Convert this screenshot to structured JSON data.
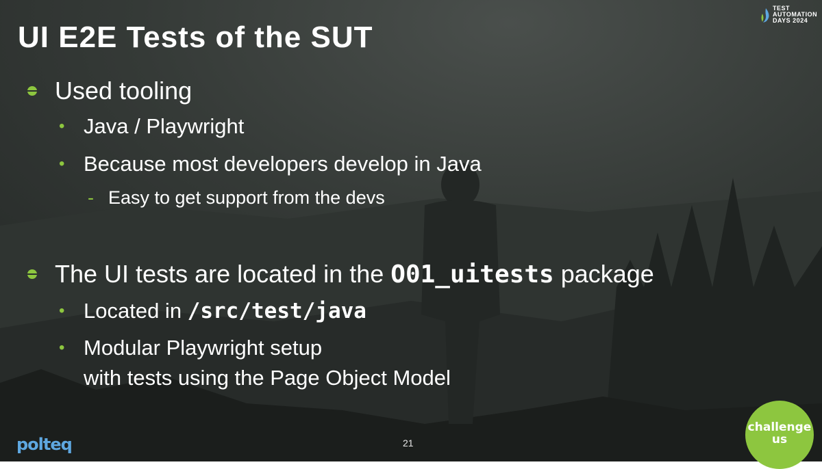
{
  "slide": {
    "title": "UI E2E Tests of the SUT",
    "page_number": "21",
    "sections": [
      {
        "heading": "Used tooling",
        "items": [
          {
            "text": "Java / Playwright"
          },
          {
            "text": "Because most developers develop in Java",
            "sub": "Easy to get support from the devs"
          }
        ]
      },
      {
        "heading_pre": "The UI tests are located in the ",
        "heading_code": "O01_uitests",
        "heading_post": " package",
        "items": [
          {
            "pre": "Located in ",
            "code": "/src/test/java"
          },
          {
            "line1": "Modular Playwright setup",
            "line2": "with tests using the Page Object Model"
          }
        ]
      }
    ]
  },
  "logos": {
    "tad_line1": "TEST",
    "tad_line2": "AUTOMATION",
    "tad_line3": "DAYS 2024",
    "polteq": "polteq",
    "challenge_line1": "challenge",
    "challenge_line2": "us"
  },
  "colors": {
    "accent": "#8dc63f",
    "background": "#2e3330",
    "text": "#ffffff"
  }
}
